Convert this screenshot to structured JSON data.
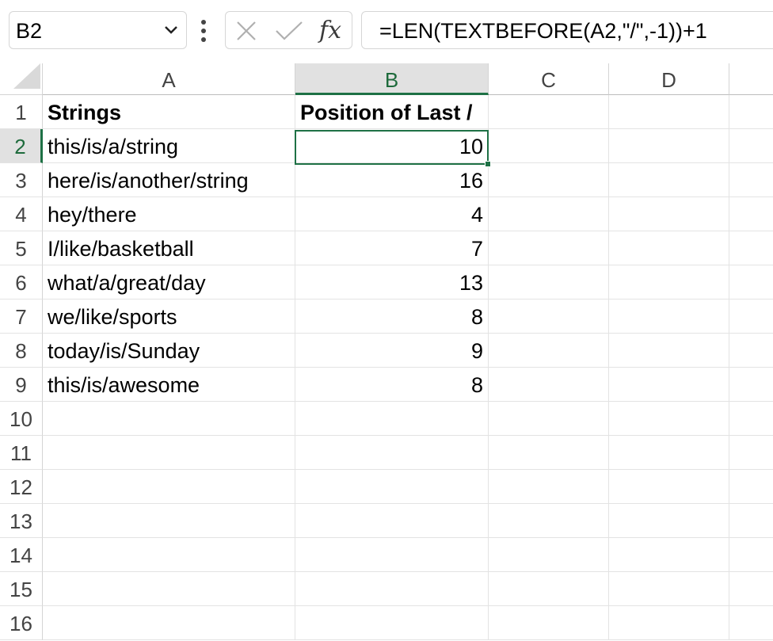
{
  "name_box": {
    "value": "B2"
  },
  "formula_bar": {
    "fx_label": "fx",
    "formula": "=LEN(TEXTBEFORE(A2,\"/\",-1))+1"
  },
  "columns": [
    "A",
    "B",
    "C",
    "D"
  ],
  "selected_column": "B",
  "rows": [
    {
      "number": "1",
      "a": "Strings",
      "b": "Position of Last /"
    },
    {
      "number": "2",
      "a": "this/is/a/string",
      "b": "10"
    },
    {
      "number": "3",
      "a": "here/is/another/string",
      "b": "16"
    },
    {
      "number": "4",
      "a": "hey/there",
      "b": "4"
    },
    {
      "number": "5",
      "a": "I/like/basketball",
      "b": "7"
    },
    {
      "number": "6",
      "a": "what/a/great/day",
      "b": "13"
    },
    {
      "number": "7",
      "a": "we/like/sports",
      "b": "8"
    },
    {
      "number": "8",
      "a": "today/is/Sunday",
      "b": "9"
    },
    {
      "number": "9",
      "a": "this/is/awesome",
      "b": "8"
    },
    {
      "number": "10",
      "a": "",
      "b": ""
    },
    {
      "number": "11",
      "a": "",
      "b": ""
    },
    {
      "number": "12",
      "a": "",
      "b": ""
    },
    {
      "number": "13",
      "a": "",
      "b": ""
    },
    {
      "number": "14",
      "a": "",
      "b": ""
    },
    {
      "number": "15",
      "a": "",
      "b": ""
    },
    {
      "number": "16",
      "a": "",
      "b": ""
    }
  ],
  "selected_row": "2",
  "colors": {
    "accent": "#1e7145",
    "header_selected_bg": "#e1e1e1",
    "gridline": "#e3e3e3"
  }
}
